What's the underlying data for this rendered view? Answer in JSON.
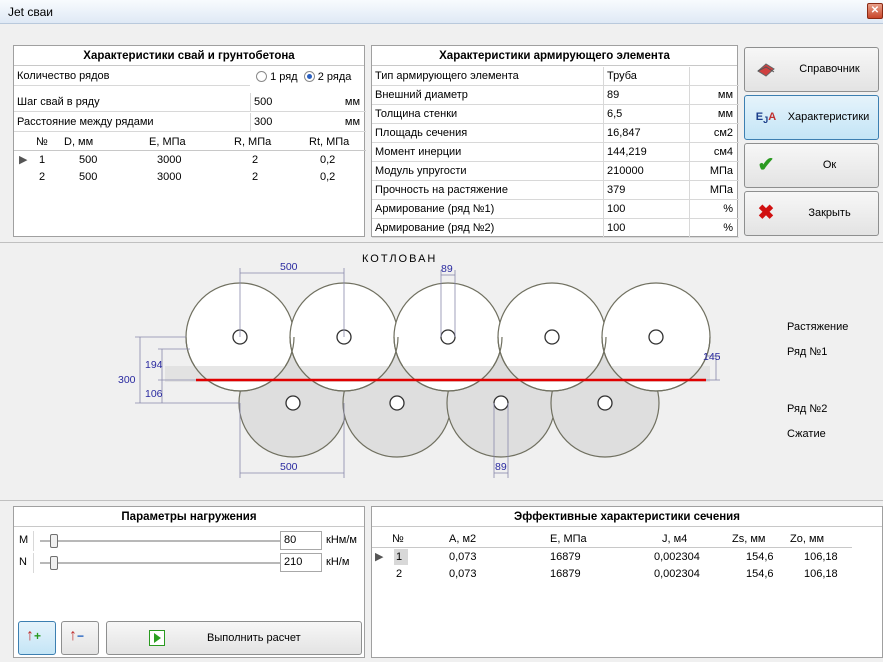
{
  "window": {
    "title": "Jet сваи",
    "close": "✕"
  },
  "piles": {
    "title": "Характеристики свай и грунтобетона",
    "rows_count_label": "Количество рядов",
    "radio1": "1 ряд",
    "radio2": "2 ряда",
    "spacing_label": "Шаг свай в ряду",
    "spacing_value": "500",
    "spacing_unit": "мм",
    "row_distance_label": "Расстояние между рядами",
    "row_distance_value": "300",
    "row_distance_unit": "мм",
    "columns": [
      "№",
      "D, мм",
      "E, МПа",
      "R, МПа",
      "Rt, МПа"
    ],
    "rows": [
      [
        "1",
        "500",
        "3000",
        "2",
        "0,2"
      ],
      [
        "2",
        "500",
        "3000",
        "2",
        "0,2"
      ]
    ]
  },
  "reinforcement": {
    "title": "Характеристики армирующего элемента",
    "rows": [
      {
        "label": "Тип армирующего элемента",
        "value": "Труба",
        "unit": ""
      },
      {
        "label": "Внешний диаметр",
        "value": "89",
        "unit": "мм"
      },
      {
        "label": "Толщина стенки",
        "value": "6,5",
        "unit": "мм"
      },
      {
        "label": "Площадь сечения",
        "value": "16,847",
        "unit": "см2"
      },
      {
        "label": "Момент инерции",
        "value": "144,219",
        "unit": "см4"
      },
      {
        "label": "Модуль упругости",
        "value": "210000",
        "unit": "МПа"
      },
      {
        "label": "Прочность на растяжение",
        "value": "379",
        "unit": "МПа"
      },
      {
        "label": "Армирование (ряд №1)",
        "value": "100",
        "unit": "%"
      },
      {
        "label": "Армирование (ряд №2)",
        "value": "100",
        "unit": "%"
      }
    ]
  },
  "buttons": {
    "reference": "Справочник",
    "characteristics": "Характеристики",
    "ok": "Ок",
    "close": "Закрыть"
  },
  "drawing": {
    "pit_label": "КОТЛОВАН",
    "dim_top_500": "500",
    "dim_top_89": "89",
    "dim_bottom_500": "500",
    "dim_bottom_89": "89",
    "dim_300": "300",
    "dim_194": "194",
    "dim_106": "106",
    "dim_145": "145",
    "tension": "Растяжение",
    "row1": "Ряд №1",
    "row2": "Ряд №2",
    "compression": "Сжатие"
  },
  "loading": {
    "title": "Параметры нагружения",
    "m_label": "M",
    "m_value": "80",
    "m_unit": "кНм/м",
    "n_label": "N",
    "n_value": "210",
    "n_unit": "кН/м",
    "run": "Выполнить расчет"
  },
  "effective": {
    "title": "Эффективные характеристики сечения",
    "columns": [
      "№",
      "A, м2",
      "E, МПа",
      "J, м4",
      "Zs, мм",
      "Zo, мм"
    ],
    "rows": [
      [
        "1",
        "0,073",
        "16879",
        "0,002304",
        "154,6",
        "106,18"
      ],
      [
        "2",
        "0,073",
        "16879",
        "0,002304",
        "154,6",
        "106,18"
      ]
    ]
  },
  "colors": {
    "neutral_line": "#e00000",
    "dimension": "#8888cc",
    "selected_button": "#c4e5f6"
  }
}
